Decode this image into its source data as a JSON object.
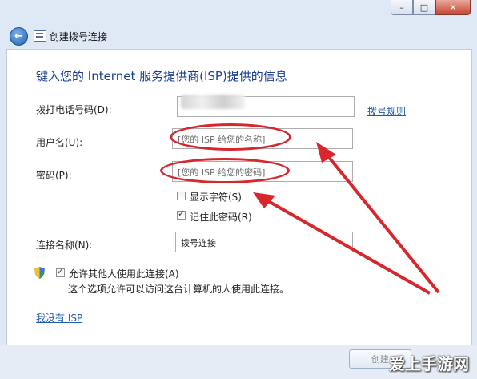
{
  "window": {
    "title": "创建拨号连接",
    "buttons": {
      "minimize": "–",
      "maximize": "□",
      "close": "✕"
    }
  },
  "form": {
    "heading": "键入您的 Internet 服务提供商(ISP)提供的信息",
    "phone": {
      "label": "拨打电话号码(D):",
      "value": ""
    },
    "dialing_rules_link": "拨号规则",
    "username": {
      "label": "用户名(U):",
      "placeholder": "[您的 ISP 给您的名称]"
    },
    "password": {
      "label": "密码(P):",
      "placeholder": "[您的 ISP 给您的密码]"
    },
    "show_chars": {
      "label": "显示字符(S)",
      "checked": false
    },
    "remember_pwd": {
      "label": "记住此密码(R)",
      "checked": true
    },
    "connection_name": {
      "label": "连接名称(N):",
      "value": "拨号连接"
    },
    "allow_others": {
      "label": "允许其他人使用此连接(A)",
      "checked": true
    },
    "allow_others_desc": "这个选项允许可以访问这台计算机的人使用此连接。",
    "no_isp_link": "我没有 ISP"
  },
  "footer": {
    "create_button": "创建"
  },
  "watermark": "爱上手游网",
  "colors": {
    "annotation": "#d7262c",
    "heading": "#1b3f8f",
    "link": "#1f5aa8"
  }
}
